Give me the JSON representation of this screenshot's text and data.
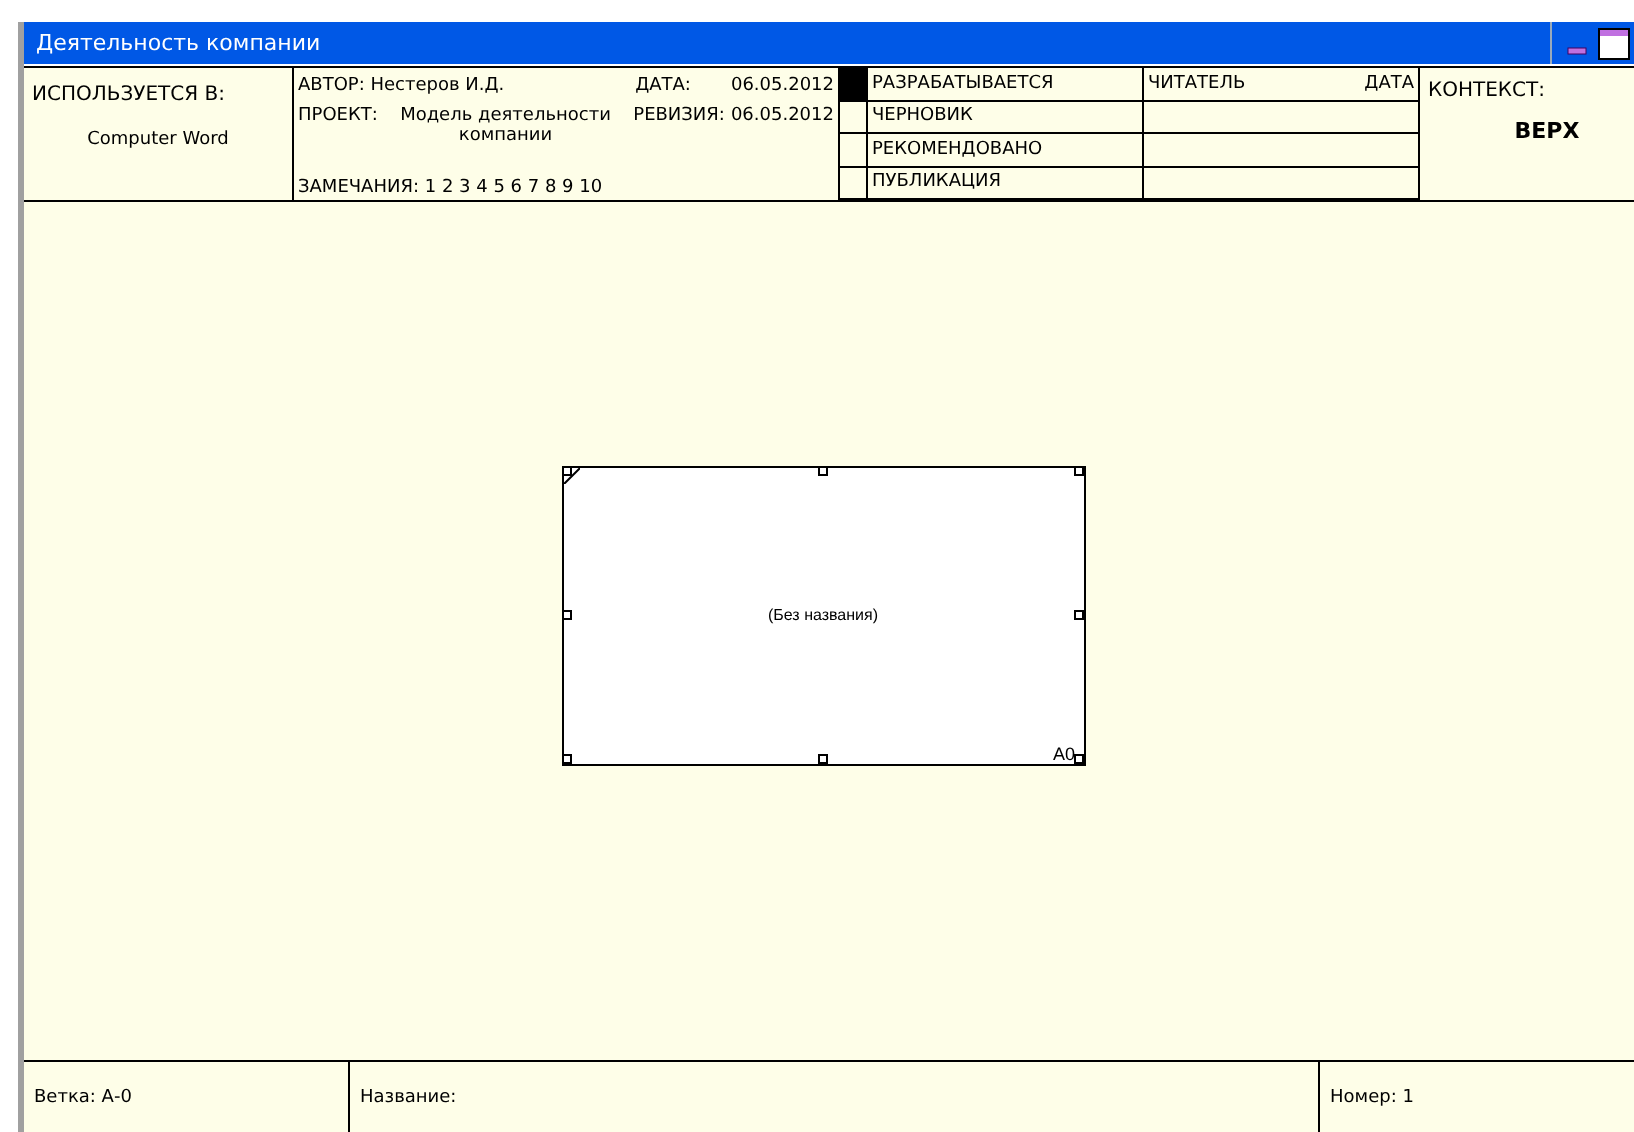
{
  "window": {
    "title": "Деятельность компании"
  },
  "header": {
    "used_in_label": "ИСПОЛЬЗУЕТСЯ В:",
    "used_in_value": "Computer Word",
    "author": "АВТОР: Нестеров И.Д.",
    "date_label": "ДАТА:",
    "date_value": "06.05.2012",
    "project_label": "ПРОЕКТ:",
    "project_value": "Модель деятельности компании",
    "revision_label": "РЕВИЗИЯ:",
    "revision_value": "06.05.2012",
    "notes": "ЗАМЕЧАНИЯ:  1  2  3  4  5  6  7  8  9  10",
    "statuses": [
      {
        "label": "РАЗРАБАТЫВАЕТСЯ",
        "selected": true
      },
      {
        "label": "ЧЕРНОВИК",
        "selected": false
      },
      {
        "label": "РЕКОМЕНДОВАНО",
        "selected": false
      },
      {
        "label": "ПУБЛИКАЦИЯ",
        "selected": false
      }
    ],
    "reader_label": "ЧИТАТЕЛЬ",
    "reader_date_label": "ДАТА",
    "context_label": "КОНТЕКСТ:",
    "context_value": "ВЕРХ"
  },
  "diagram": {
    "box_title": "(Без названия)",
    "box_number": "A0"
  },
  "footer": {
    "node": "Ветка:  А-0",
    "title": "Название:",
    "number": "Номер: 1"
  }
}
